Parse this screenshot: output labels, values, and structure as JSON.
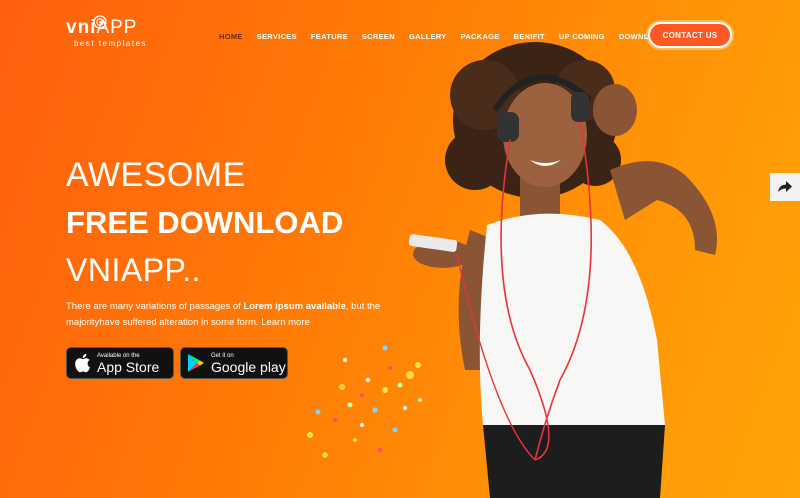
{
  "logo": {
    "bold": "vni",
    "light": "APP",
    "tagline": "best templates"
  },
  "nav": {
    "items": [
      "HOME",
      "SERVICES",
      "FEATURE",
      "SCREEN",
      "GALLERY",
      "PACKAGE",
      "BENIFIT",
      "UP COMING",
      "DOWNLOAD APP"
    ],
    "active": "HOME",
    "contact_label": "CONTACT US"
  },
  "hero": {
    "line1": "AWESOME",
    "line2": "FREE DOWNLOAD",
    "line3": "VNIAPP..",
    "desc_part1": "There are many variations of passages of ",
    "desc_bold": "Lorem ipsum available",
    "desc_part2": ", but the majorityhave suffered alteration in some form. Learn more"
  },
  "badges": {
    "apple": {
      "small": "Available on the",
      "big": "App Store"
    },
    "google": {
      "small": "Get it on",
      "big": "Google play"
    }
  },
  "icons": {
    "share": "share-icon",
    "apple": "apple-icon",
    "google": "google-play-icon"
  },
  "colors": {
    "bg_start": "#ff5f0d",
    "bg_end": "#ffa407",
    "nav_active": "#6b2d06",
    "button": "#ff5722"
  }
}
